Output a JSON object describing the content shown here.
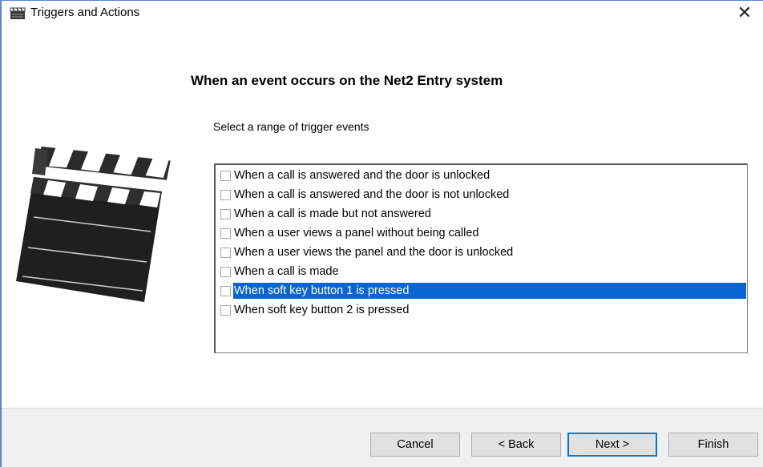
{
  "window": {
    "title": "Triggers and Actions",
    "close_glyph": "✕"
  },
  "page": {
    "heading": "When an event occurs on the Net2 Entry system",
    "subheading": "Select a range of trigger events"
  },
  "trigger_list": {
    "items": [
      {
        "label": "When a call is answered and the door is unlocked",
        "checked": false,
        "selected": false
      },
      {
        "label": "When a call is answered and the door is not unlocked",
        "checked": false,
        "selected": false
      },
      {
        "label": "When a call is made but not answered",
        "checked": false,
        "selected": false
      },
      {
        "label": "When a user views a panel without being called",
        "checked": false,
        "selected": false
      },
      {
        "label": "When a user views the panel and the door is unlocked",
        "checked": false,
        "selected": false
      },
      {
        "label": "When a call is made",
        "checked": false,
        "selected": false
      },
      {
        "label": "When soft key button 1 is pressed",
        "checked": false,
        "selected": true
      },
      {
        "label": "When soft key button 2 is pressed",
        "checked": false,
        "selected": false
      }
    ]
  },
  "buttons": {
    "cancel": "Cancel",
    "back": "< Back",
    "next": "Next >",
    "finish": "Finish"
  },
  "icons": {
    "window": "clapperboard-icon",
    "illustration": "clapperboard-icon"
  },
  "colors": {
    "selection": "#0a64d6",
    "window_border": "#5b86c9",
    "default_button_border": "#0078d7"
  }
}
